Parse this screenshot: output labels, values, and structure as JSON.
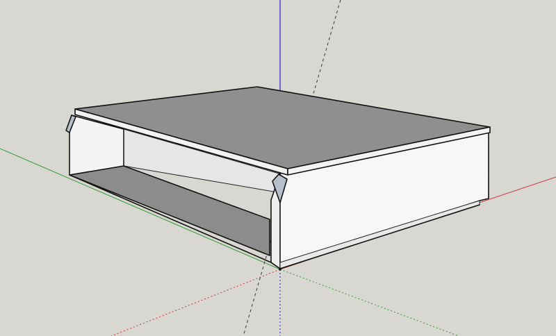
{
  "viewport": {
    "background_color": "#d9d7d2",
    "axes": {
      "red_color": "#cc3333",
      "green_color": "#2f9e2f",
      "blue_color": "#2323c8",
      "dashed_guide_color": "#333333"
    },
    "model": {
      "top_face_color": "#8f8f8f",
      "side_face_color": "#f2f2f2",
      "inner_back_color": "#e6e6e6",
      "inner_floor_color": "#8c8c8c",
      "chamfer_color": "#b7bfcb",
      "edge_color": "#111111"
    }
  }
}
